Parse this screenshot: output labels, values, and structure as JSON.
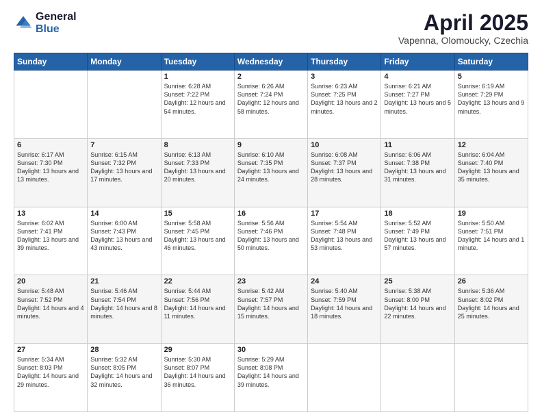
{
  "logo": {
    "general": "General",
    "blue": "Blue"
  },
  "title": {
    "month": "April 2025",
    "location": "Vapenna, Olomoucky, Czechia"
  },
  "weekdays": [
    "Sunday",
    "Monday",
    "Tuesday",
    "Wednesday",
    "Thursday",
    "Friday",
    "Saturday"
  ],
  "weeks": [
    [
      {
        "day": "",
        "info": ""
      },
      {
        "day": "",
        "info": ""
      },
      {
        "day": "1",
        "info": "Sunrise: 6:28 AM\nSunset: 7:22 PM\nDaylight: 12 hours\nand 54 minutes."
      },
      {
        "day": "2",
        "info": "Sunrise: 6:26 AM\nSunset: 7:24 PM\nDaylight: 12 hours\nand 58 minutes."
      },
      {
        "day": "3",
        "info": "Sunrise: 6:23 AM\nSunset: 7:25 PM\nDaylight: 13 hours\nand 2 minutes."
      },
      {
        "day": "4",
        "info": "Sunrise: 6:21 AM\nSunset: 7:27 PM\nDaylight: 13 hours\nand 5 minutes."
      },
      {
        "day": "5",
        "info": "Sunrise: 6:19 AM\nSunset: 7:29 PM\nDaylight: 13 hours\nand 9 minutes."
      }
    ],
    [
      {
        "day": "6",
        "info": "Sunrise: 6:17 AM\nSunset: 7:30 PM\nDaylight: 13 hours\nand 13 minutes."
      },
      {
        "day": "7",
        "info": "Sunrise: 6:15 AM\nSunset: 7:32 PM\nDaylight: 13 hours\nand 17 minutes."
      },
      {
        "day": "8",
        "info": "Sunrise: 6:13 AM\nSunset: 7:33 PM\nDaylight: 13 hours\nand 20 minutes."
      },
      {
        "day": "9",
        "info": "Sunrise: 6:10 AM\nSunset: 7:35 PM\nDaylight: 13 hours\nand 24 minutes."
      },
      {
        "day": "10",
        "info": "Sunrise: 6:08 AM\nSunset: 7:37 PM\nDaylight: 13 hours\nand 28 minutes."
      },
      {
        "day": "11",
        "info": "Sunrise: 6:06 AM\nSunset: 7:38 PM\nDaylight: 13 hours\nand 31 minutes."
      },
      {
        "day": "12",
        "info": "Sunrise: 6:04 AM\nSunset: 7:40 PM\nDaylight: 13 hours\nand 35 minutes."
      }
    ],
    [
      {
        "day": "13",
        "info": "Sunrise: 6:02 AM\nSunset: 7:41 PM\nDaylight: 13 hours\nand 39 minutes."
      },
      {
        "day": "14",
        "info": "Sunrise: 6:00 AM\nSunset: 7:43 PM\nDaylight: 13 hours\nand 43 minutes."
      },
      {
        "day": "15",
        "info": "Sunrise: 5:58 AM\nSunset: 7:45 PM\nDaylight: 13 hours\nand 46 minutes."
      },
      {
        "day": "16",
        "info": "Sunrise: 5:56 AM\nSunset: 7:46 PM\nDaylight: 13 hours\nand 50 minutes."
      },
      {
        "day": "17",
        "info": "Sunrise: 5:54 AM\nSunset: 7:48 PM\nDaylight: 13 hours\nand 53 minutes."
      },
      {
        "day": "18",
        "info": "Sunrise: 5:52 AM\nSunset: 7:49 PM\nDaylight: 13 hours\nand 57 minutes."
      },
      {
        "day": "19",
        "info": "Sunrise: 5:50 AM\nSunset: 7:51 PM\nDaylight: 14 hours\nand 1 minute."
      }
    ],
    [
      {
        "day": "20",
        "info": "Sunrise: 5:48 AM\nSunset: 7:52 PM\nDaylight: 14 hours\nand 4 minutes."
      },
      {
        "day": "21",
        "info": "Sunrise: 5:46 AM\nSunset: 7:54 PM\nDaylight: 14 hours\nand 8 minutes."
      },
      {
        "day": "22",
        "info": "Sunrise: 5:44 AM\nSunset: 7:56 PM\nDaylight: 14 hours\nand 11 minutes."
      },
      {
        "day": "23",
        "info": "Sunrise: 5:42 AM\nSunset: 7:57 PM\nDaylight: 14 hours\nand 15 minutes."
      },
      {
        "day": "24",
        "info": "Sunrise: 5:40 AM\nSunset: 7:59 PM\nDaylight: 14 hours\nand 18 minutes."
      },
      {
        "day": "25",
        "info": "Sunrise: 5:38 AM\nSunset: 8:00 PM\nDaylight: 14 hours\nand 22 minutes."
      },
      {
        "day": "26",
        "info": "Sunrise: 5:36 AM\nSunset: 8:02 PM\nDaylight: 14 hours\nand 25 minutes."
      }
    ],
    [
      {
        "day": "27",
        "info": "Sunrise: 5:34 AM\nSunset: 8:03 PM\nDaylight: 14 hours\nand 29 minutes."
      },
      {
        "day": "28",
        "info": "Sunrise: 5:32 AM\nSunset: 8:05 PM\nDaylight: 14 hours\nand 32 minutes."
      },
      {
        "day": "29",
        "info": "Sunrise: 5:30 AM\nSunset: 8:07 PM\nDaylight: 14 hours\nand 36 minutes."
      },
      {
        "day": "30",
        "info": "Sunrise: 5:29 AM\nSunset: 8:08 PM\nDaylight: 14 hours\nand 39 minutes."
      },
      {
        "day": "",
        "info": ""
      },
      {
        "day": "",
        "info": ""
      },
      {
        "day": "",
        "info": ""
      }
    ]
  ]
}
